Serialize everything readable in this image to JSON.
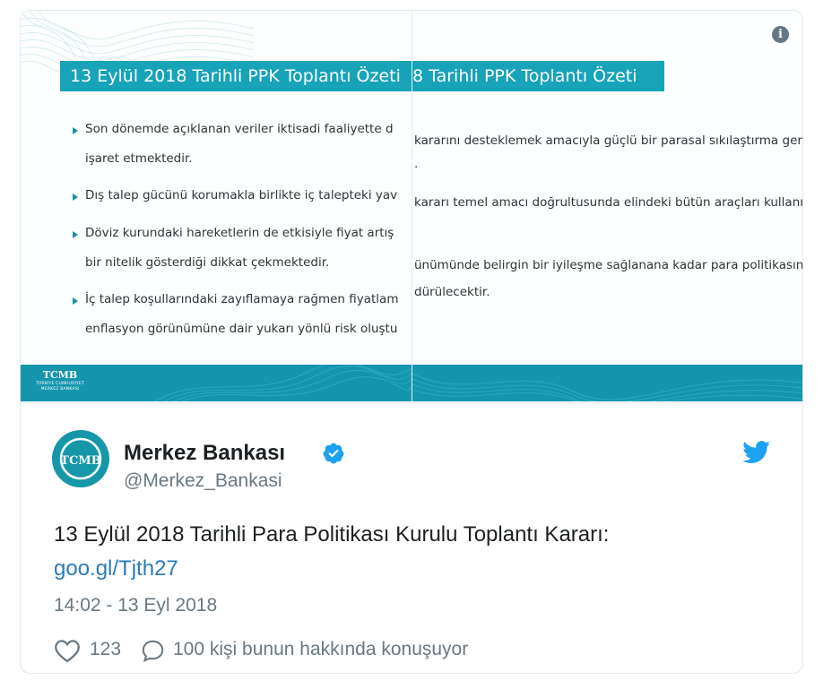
{
  "media": {
    "slide_left": {
      "title": "13 Eylül 2018 Tarihli PPK Toplantı Özeti",
      "lines": [
        "Son dönemde açıklanan veriler iktisadi faaliyette d",
        "işaret etmektedir.",
        "Dış talep gücünü korumakla birlikte iç talepteki yav",
        "Döviz kurundaki hareketlerin de etkisiyle fiyat artış",
        "bir nitelik gösterdiği dikkat çekmektedir.",
        "İç talep koşullarındaki zayıflamaya rağmen fiyatlam",
        "enflasyon görünümüne dair yukarı yönlü risk oluştu"
      ],
      "logo_mono": "TCMB",
      "logo_line1": "TÜRKİYE CUMHURİYET",
      "logo_line2": "MERKEZ BANKASI"
    },
    "slide_right": {
      "title": "8 Tarihli PPK Toplantı Özeti",
      "lines": [
        "kararını desteklemek amacıyla güçlü bir parasal sıkılaştırma gerç",
        ".",
        "kararı temel amacı doğrultusunda elindeki bütün araçları kullanm",
        "ünümünde belirgin bir iyileşme sağlanana kadar para politikasını",
        "dürülecektir."
      ]
    },
    "info_icon_glyph": "i"
  },
  "tweet": {
    "name": "Merkez Bankası",
    "handle": "@Merkez_Bankasi",
    "text": "13 Eylül 2018 Tarihli Para Politikası Kurulu Toplantı Kararı:",
    "link": "goo.gl/Tjth27",
    "timestamp": "14:02 - 13 Eyl 2018",
    "likes": "123",
    "replies_text": "100 kişi bunun hakkında konuşuyor",
    "avatar_mono": "TCMB"
  },
  "colors": {
    "accent_teal": "#17a3b8",
    "link_blue": "#2b7bb9",
    "twitter_blue": "#1da1f2",
    "muted_gray": "#697882"
  },
  "icons": {
    "info": "info-icon",
    "verified": "verified-badge-icon",
    "bird": "twitter-bird-icon",
    "like": "heart-icon",
    "reply": "reply-bubble-icon"
  }
}
